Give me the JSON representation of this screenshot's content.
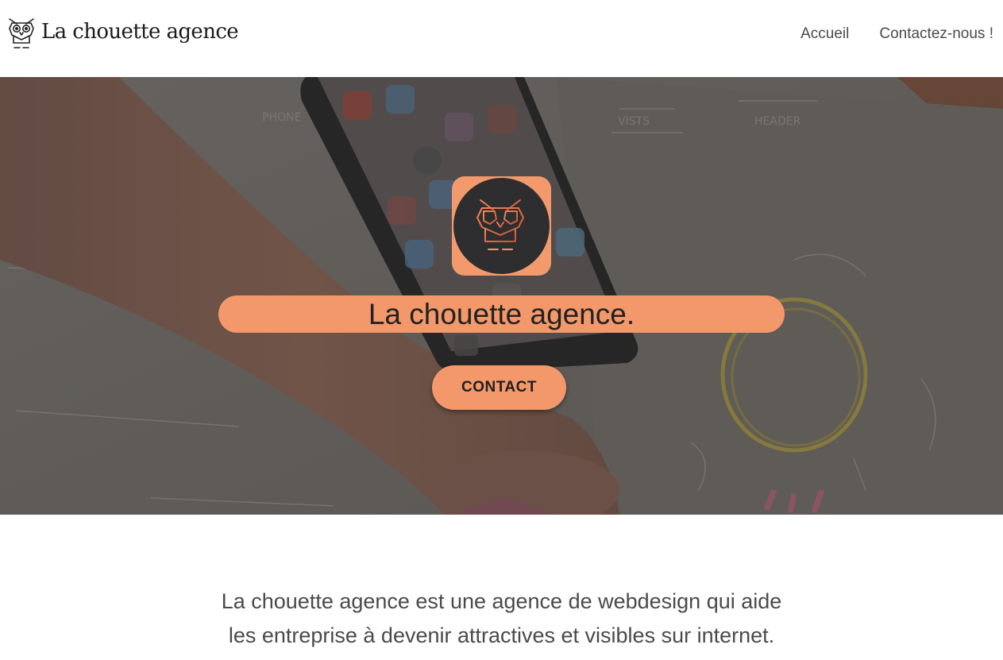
{
  "header": {
    "brand_name": "La chouette agence",
    "nav": [
      {
        "label": "Accueil"
      },
      {
        "label": "Contactez-nous !"
      }
    ]
  },
  "hero": {
    "title": "La chouette agence.",
    "cta_label": "CONTACT",
    "background_image": "phone-and-wireframe-sketches-photo",
    "logo_icon": "owl-icon"
  },
  "intro": {
    "line1": "La chouette agence est une agence de webdesign qui aide",
    "line2": "les entreprise à devenir attractives et visibles sur internet."
  },
  "colors": {
    "accent": "#f3986b",
    "logo_dark": "#2e2d30",
    "text_dark": "#222222",
    "text_gray": "#4a4a4a",
    "background": "#ffffff"
  }
}
